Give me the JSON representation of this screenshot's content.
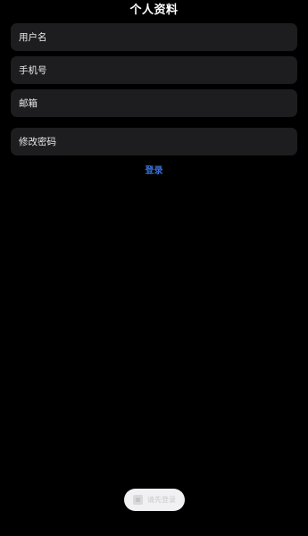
{
  "header": {
    "title": "个人资料"
  },
  "form": {
    "username_label": "用户名",
    "phone_label": "手机号",
    "email_label": "邮箱",
    "change_password_label": "修改密码"
  },
  "actions": {
    "login_label": "登录"
  },
  "toast": {
    "icon": "app-icon",
    "text": "请先登录"
  },
  "colors": {
    "background": "#000000",
    "row_background": "#1d1d1f",
    "accent": "#3a6fd6",
    "toast_background": "#f1f1f3"
  }
}
